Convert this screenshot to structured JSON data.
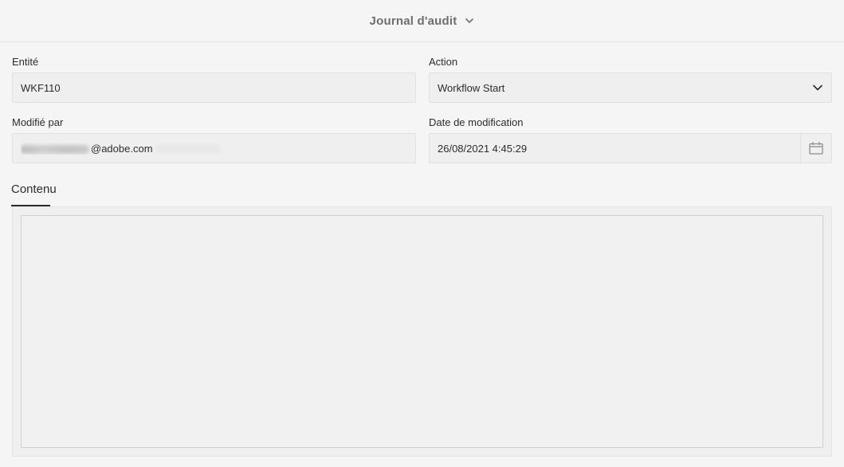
{
  "header": {
    "title": "Journal d'audit",
    "dropdown_icon": "chevron-down-icon"
  },
  "form": {
    "entity": {
      "label": "Entité",
      "value": "WKF110"
    },
    "action": {
      "label": "Action",
      "value": "Workflow Start",
      "icon": "chevron-down-icon"
    },
    "modified_by": {
      "label": "Modifié par",
      "value_visible_suffix": "@adobe.com"
    },
    "modified_date": {
      "label": "Date de modification",
      "value": "26/08/2021 4:45:29",
      "icon": "calendar-icon"
    }
  },
  "tabs": [
    {
      "label": "Contenu",
      "active": true
    }
  ],
  "content": {
    "value": ""
  },
  "colors": {
    "background": "#f5f5f5",
    "field_bg": "#efefef",
    "border": "#e1e1e1",
    "text": "#2c2c2c",
    "header_text": "#6e6e6e"
  }
}
